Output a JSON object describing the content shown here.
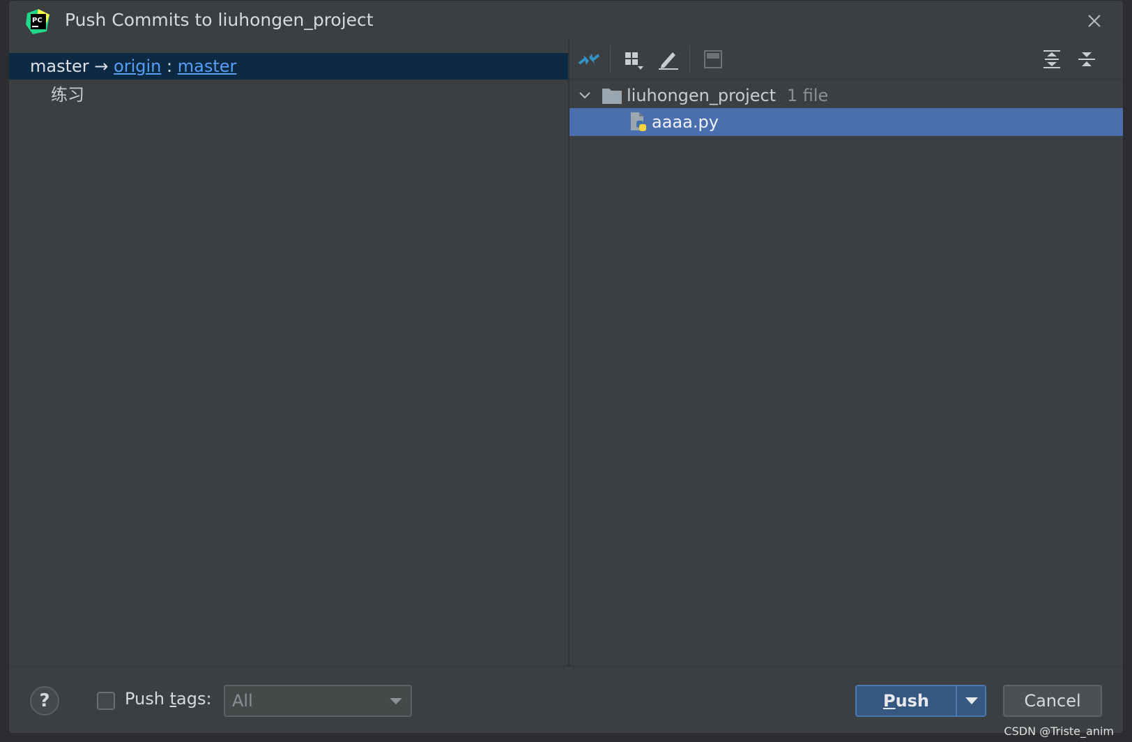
{
  "dialog": {
    "title": "Push Commits to liuhongen_project",
    "app_icon_text": "PC"
  },
  "left": {
    "branch": {
      "local": "master",
      "arrow": "→",
      "remote": "origin",
      "sep": ":",
      "remote_branch": "master"
    },
    "commits": [
      "练习"
    ]
  },
  "right": {
    "toolbar": {
      "icons": [
        "show-diff-icon",
        "group-by-icon",
        "edit-source-icon",
        "preview-icon",
        "expand-all-icon",
        "collapse-all-icon"
      ]
    },
    "tree": {
      "folder": {
        "name": "liuhongen_project",
        "count": "1 file"
      },
      "file": {
        "name": "aaaa.py"
      }
    }
  },
  "bottom": {
    "help": "?",
    "push_tags_prefix": "Push ",
    "push_tags_mnemonic": "t",
    "push_tags_suffix": "ags:",
    "tags_combo_value": "All",
    "push_mnemonic": "P",
    "push_rest": "ush",
    "cancel_label": "Cancel",
    "watermark": "CSDN @Triste_anim"
  },
  "colors": {
    "background": "#3c3f41",
    "selection_branch": "#0d2a45",
    "selection_file": "#4b6eaf",
    "link": "#589df6",
    "primary_button": "#365880"
  }
}
